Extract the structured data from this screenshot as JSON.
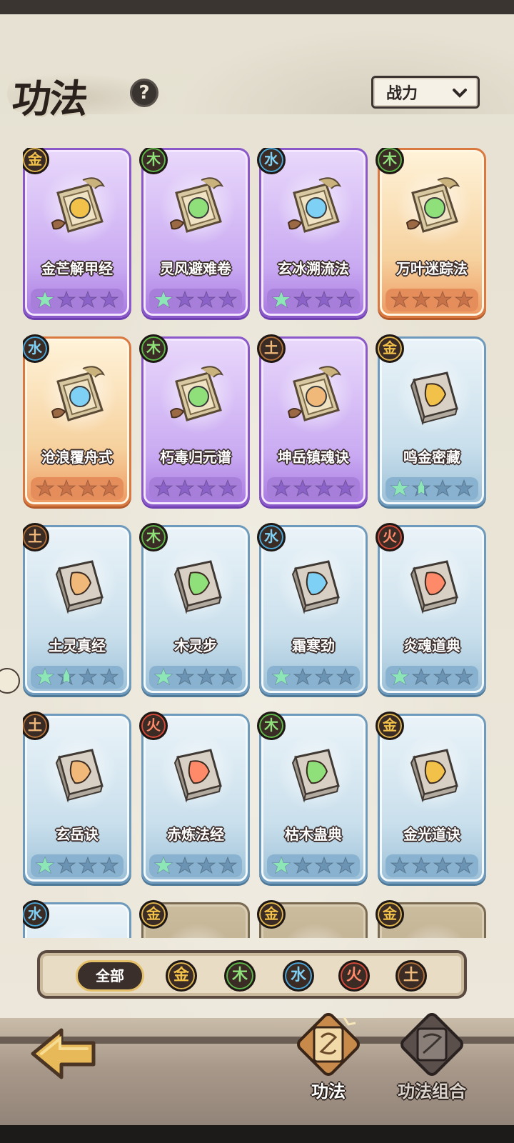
{
  "header": {
    "title": "功法",
    "help_symbol": "?"
  },
  "sort": {
    "selected": "战力"
  },
  "colors": {
    "gold": "#f2c14a",
    "wood": "#8fe07a",
    "water": "#7fd0f5",
    "fire": "#ff8a6a",
    "earth": "#f0b879"
  },
  "cards": [
    {
      "name": "金芒解甲经",
      "element": "金",
      "rarity": "purple",
      "stars_lit": 1,
      "icon": "golden-armor-scroll-icon"
    },
    {
      "name": "灵风避难卷",
      "element": "木",
      "rarity": "purple",
      "stars_lit": 1,
      "icon": "leaf-scroll-icon"
    },
    {
      "name": "玄冰溯流法",
      "element": "水",
      "rarity": "purple",
      "stars_lit": 1,
      "icon": "water-wave-scroll-icon"
    },
    {
      "name": "万叶迷踪法",
      "element": "木",
      "rarity": "orange",
      "stars_lit": 0,
      "icon": "jade-leaf-scroll-icon"
    },
    {
      "name": "沧浪覆舟式",
      "element": "水",
      "rarity": "orange",
      "stars_lit": 0,
      "icon": "ice-wave-scroll-icon"
    },
    {
      "name": "朽毒归元谱",
      "element": "木",
      "rarity": "purple",
      "stars_lit": 0,
      "icon": "poison-skull-scroll-icon"
    },
    {
      "name": "坤岳镇魂诀",
      "element": "土",
      "rarity": "purple",
      "stars_lit": 0,
      "icon": "earth-rock-scroll-icon"
    },
    {
      "name": "鸣金密藏",
      "element": "金",
      "rarity": "blue",
      "stars_lit": 1.5,
      "icon": "gold-shield-book-icon"
    },
    {
      "name": "土灵真经",
      "element": "土",
      "rarity": "blue",
      "stars_lit": 1.5,
      "icon": "earth-book-icon"
    },
    {
      "name": "木灵步",
      "element": "木",
      "rarity": "blue",
      "stars_lit": 1,
      "icon": "leaf-book-icon"
    },
    {
      "name": "霜寒劲",
      "element": "水",
      "rarity": "blue",
      "stars_lit": 1,
      "icon": "ice-crystal-book-icon"
    },
    {
      "name": "炎魂道典",
      "element": "火",
      "rarity": "blue",
      "stars_lit": 1,
      "icon": "flame-book-icon"
    },
    {
      "name": "玄岳诀",
      "element": "土",
      "rarity": "blue",
      "stars_lit": 1,
      "icon": "axe-book-icon"
    },
    {
      "name": "赤炼法经",
      "element": "火",
      "rarity": "blue",
      "stars_lit": 1,
      "icon": "fire-claw-book-icon"
    },
    {
      "name": "枯木蛊典",
      "element": "木",
      "rarity": "blue",
      "stars_lit": 1,
      "icon": "poison-skull-book-icon"
    },
    {
      "name": "金光道诀",
      "element": "金",
      "rarity": "blue",
      "stars_lit": 0,
      "icon": "gold-burst-book-icon"
    },
    {
      "name": "",
      "element": "水",
      "rarity": "blue",
      "stars_lit": 0,
      "icon": ""
    },
    {
      "name": "",
      "element": "金",
      "rarity": "brown",
      "stars_lit": 0,
      "icon": ""
    },
    {
      "name": "",
      "element": "金",
      "rarity": "brown",
      "stars_lit": 0,
      "icon": ""
    },
    {
      "name": "",
      "element": "金",
      "rarity": "brown",
      "stars_lit": 0,
      "icon": ""
    }
  ],
  "filters": {
    "all": "全部",
    "elements": [
      "金",
      "木",
      "水",
      "火",
      "土"
    ]
  },
  "nav": {
    "tab1": "功法",
    "tab2": "功法组合"
  }
}
